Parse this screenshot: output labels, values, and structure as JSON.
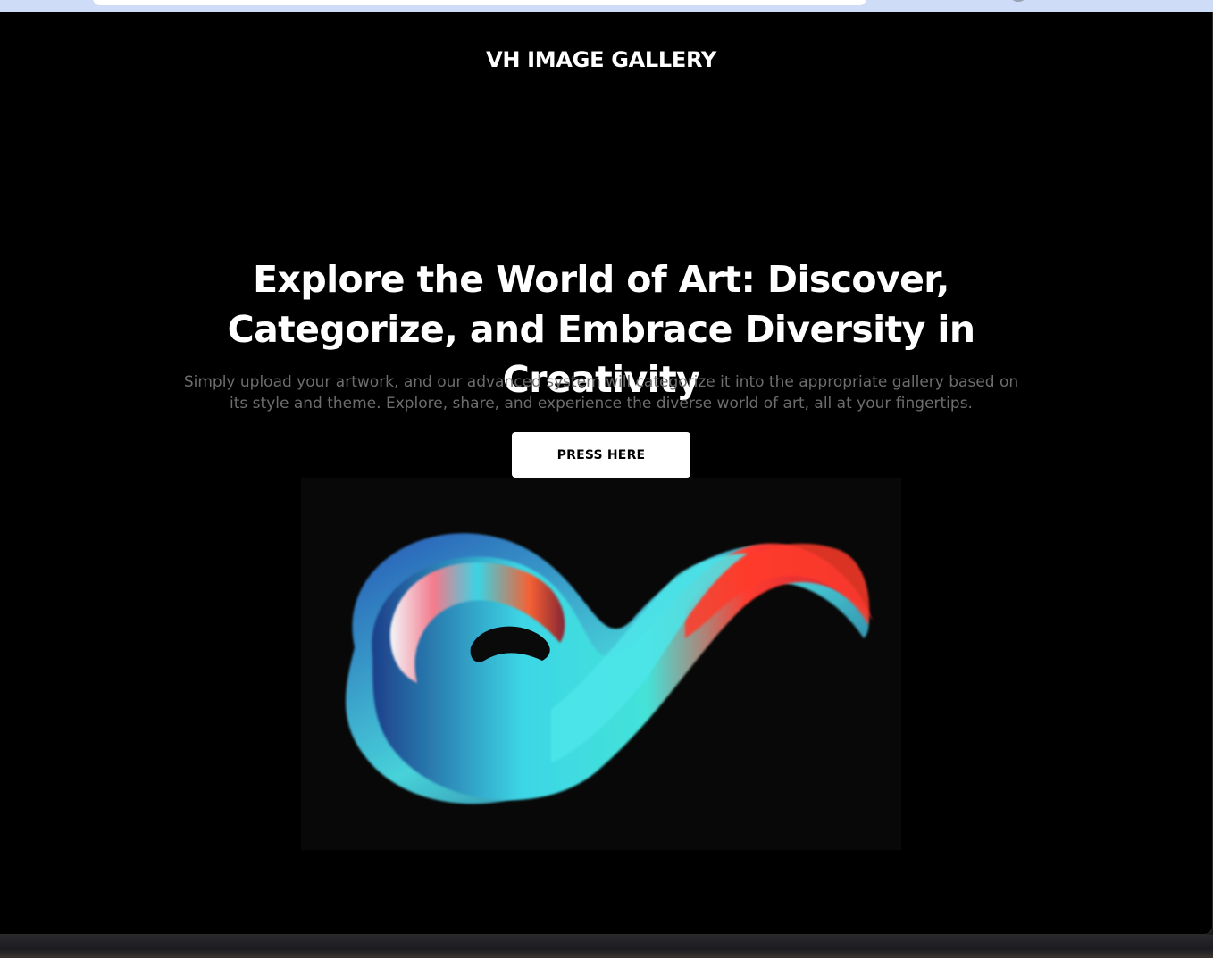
{
  "header": {
    "brand": "VH IMAGE GALLERY"
  },
  "hero": {
    "title": "Explore the World of Art: Discover, Categorize, and Embrace Diversity in Creativity",
    "subtitle": "Simply upload your artwork, and our advanced system will categorize it into the appropriate gallery based on its style and theme. Explore, share, and experience the diverse world of art, all at your fingertips.",
    "button_label": "PRESS HERE"
  },
  "artwork": {
    "description_icon": "abstract-swirl-image"
  },
  "colors": {
    "background": "#000000",
    "text": "#ffffff",
    "subtitle": "#6d6d6d",
    "button_bg": "#ffffff",
    "button_text": "#000000"
  }
}
